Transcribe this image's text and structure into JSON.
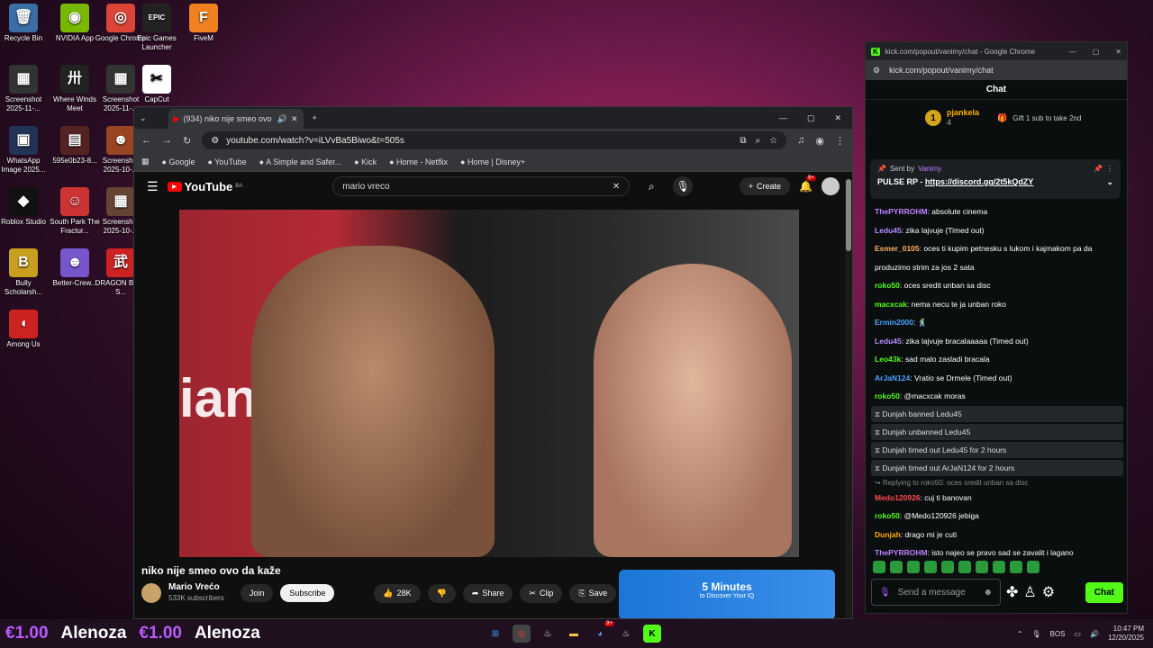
{
  "desktop": {
    "icons": [
      {
        "label": "Recycle Bin",
        "glyph": "🗑",
        "color": "#3a6ea5"
      },
      {
        "label": "NVIDIA App",
        "glyph": "◉",
        "color": "#76b900"
      },
      {
        "label": "Google Chrome",
        "glyph": "◎",
        "color": "#db4437"
      },
      {
        "label": "Epic Games Launcher",
        "glyph": "EPIC",
        "color": "#222222"
      },
      {
        "label": "FiveM",
        "glyph": "F",
        "color": "#f08020"
      },
      {
        "label": "Screenshot 2025-11-...",
        "glyph": "▦",
        "color": "#333333"
      },
      {
        "label": "Where Winds Meet",
        "glyph": "卅",
        "color": "#222222"
      },
      {
        "label": "Screenshot 2025-11-...",
        "glyph": "▦",
        "color": "#333333"
      },
      {
        "label": "CapCut",
        "glyph": "✂",
        "color": "#ffffff"
      },
      {
        "label": "WhatsApp Image 2025...",
        "glyph": "▣",
        "color": "#223355"
      },
      {
        "label": "595e0b23-8...",
        "glyph": "▤",
        "color": "#552222"
      },
      {
        "label": "Screenshot 2025-10-...",
        "glyph": "☻",
        "color": "#994422"
      },
      {
        "label": "Roblox Studio",
        "glyph": "◆",
        "color": "#111111"
      },
      {
        "label": "South Park The Fractur...",
        "glyph": "☺",
        "color": "#cc3333"
      },
      {
        "label": "Screenshot 2025-10-...",
        "glyph": "▦",
        "color": "#664433"
      },
      {
        "label": "Bully Scholarsh...",
        "glyph": "B",
        "color": "#c8a020"
      },
      {
        "label": "Better-Crew...",
        "glyph": "☻",
        "color": "#7755cc"
      },
      {
        "label": "DRAGON BALL S...",
        "glyph": "武",
        "color": "#cc2222"
      },
      {
        "label": "Among Us",
        "glyph": "◖",
        "color": "#cc2222"
      }
    ]
  },
  "youtube_window": {
    "tab_title": "(934) niko nije smeo ovo da",
    "url": "youtube.com/watch?v=iLVvBa5Biwo&t=505s",
    "bookmarks": [
      "Google",
      "YouTube",
      "A Simple and Safer...",
      "Kick",
      "Home - Netflix",
      "Home | Disney+"
    ],
    "logo": "YouTube",
    "logo_region": "BA",
    "search_value": "mario vreco",
    "create_label": "Create",
    "notif_count": "9+",
    "video_overlay_text": "ianbet",
    "video_title": "niko nije smeo ovo da kaže",
    "channel_name": "Mario Vrećo",
    "subscribers": "533K subscribers",
    "join_label": "Join",
    "subscribe_label": "Subscribe",
    "likes": "28K",
    "share_label": "Share",
    "clip_label": "Clip",
    "save_label": "Save",
    "ad_headline": "5 Minutes",
    "ad_sub": "to Discover Your IQ"
  },
  "kick_window": {
    "window_title": "kick.com/popout/vanimy/chat - Google Chrome",
    "url": "kick.com/popout/vanimy/chat",
    "header": "Chat",
    "leader_rank": "1",
    "leader_name": "pjankela",
    "leader_count": "4",
    "gift_text": "Gift 1 sub to take 2nd",
    "pinned_by": "Sent by",
    "pinned_user": "Vanimy",
    "pinned_prefix": "PULSE RP - ",
    "pinned_link": "https://discord.gg/2t5kQdZY",
    "messages": [
      {
        "user": "ThePYRROHM",
        "color": "#c080ff",
        "text": ": absolute cinema"
      },
      {
        "user": "Ledu45",
        "color": "#b68cff",
        "text": ": zika lajvuje (Timed out)"
      },
      {
        "user": "Esmer_0105",
        "color": "#ffb060",
        "text": ": oces ti kupim petnesku s lukom i kajmakom pa da"
      },
      {
        "user": "",
        "color": "#ffffff",
        "text": "produzimo strim za jos 2 sata"
      },
      {
        "user": "roko50",
        "color": "#53fc18",
        "text": ": oces sredit unban sa disc"
      },
      {
        "user": "macxcak",
        "color": "#53fc18",
        "text": ": nema necu te ja unban roko"
      },
      {
        "user": "Ermin2000",
        "color": "#4aa3ff",
        "text": ": 🕺"
      },
      {
        "user": "Ledu45",
        "color": "#b68cff",
        "text": ": zika lajvuje bracalaaaaa (Timed out)"
      },
      {
        "user": "Leo43k",
        "color": "#53fc18",
        "text": ": sad malo zasladi bracala"
      },
      {
        "user": "ArJaN124",
        "color": "#4aa3ff",
        "text": ": Vratio se Drmele (Timed out)"
      },
      {
        "user": "roko50",
        "color": "#53fc18",
        "text": ": @macxcak moras"
      }
    ],
    "system": [
      "Dunjah banned Ledu45",
      "Dunjah unbanned Ledu45",
      "Dunjah timed out Ledu45 for 2 hours",
      "Dunjah timed out ArJaN124 for 2 hours"
    ],
    "reply_note": "↪ Replying to roko50: oces sredit unban sa disc",
    "messages2": [
      {
        "user": "Medo120926",
        "color": "#ff4d4d",
        "text": ": cuj ti banovan"
      },
      {
        "user": "roko50",
        "color": "#53fc18",
        "text": ": @Medo120926 jebiga"
      },
      {
        "user": "Dunjah",
        "color": "#ffb000",
        "text": ": drago mi je cuti"
      },
      {
        "user": "ThePYRROHM",
        "color": "#c080ff",
        "text": ": isto najeo se pravo sad se zavalit i lagano"
      }
    ],
    "input_placeholder": "Send a message",
    "chat_button": "Chat"
  },
  "taskbar": {
    "ticker": [
      "€1.00",
      "Alenoza",
      "€1.00",
      "Alenoza"
    ],
    "lang": "BOS",
    "time": "10:47 PM",
    "date": "12/20/2025",
    "discord_badge": "9+"
  }
}
